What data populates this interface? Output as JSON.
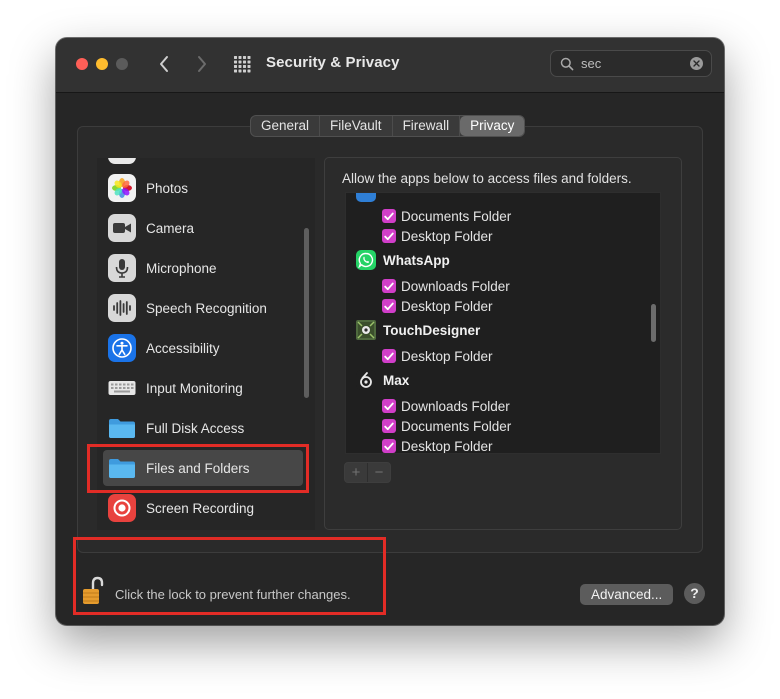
{
  "window": {
    "title": "Security & Privacy"
  },
  "search": {
    "value": "sec"
  },
  "tabs": [
    {
      "label": "General",
      "active": false
    },
    {
      "label": "FileVault",
      "active": false
    },
    {
      "label": "Firewall",
      "active": false
    },
    {
      "label": "Privacy",
      "active": true
    }
  ],
  "sidebar": {
    "items": [
      {
        "label": "Photos",
        "icon": "photos-icon"
      },
      {
        "label": "Camera",
        "icon": "camera-icon"
      },
      {
        "label": "Microphone",
        "icon": "microphone-icon"
      },
      {
        "label": "Speech Recognition",
        "icon": "speech-recognition-icon"
      },
      {
        "label": "Accessibility",
        "icon": "accessibility-icon"
      },
      {
        "label": "Input Monitoring",
        "icon": "keyboard-icon"
      },
      {
        "label": "Full Disk Access",
        "icon": "folder-icon"
      },
      {
        "label": "Files and Folders",
        "icon": "folder-icon",
        "selected": true
      },
      {
        "label": "Screen Recording",
        "icon": "screen-recording-icon"
      }
    ]
  },
  "panel": {
    "description": "Allow the apps below to access files and folders.",
    "apps": [
      {
        "name": "WhatsApp",
        "icon": "whatsapp-icon"
      },
      {
        "name": "TouchDesigner",
        "icon": "touchdesigner-icon"
      },
      {
        "name": "Max",
        "icon": "max-icon"
      }
    ],
    "permissions": {
      "first_documents": "Documents Folder",
      "first_desktop": "Desktop Folder",
      "whatsapp_downloads": "Downloads Folder",
      "whatsapp_desktop": "Desktop Folder",
      "touchdesigner_desktop": "Desktop Folder",
      "max_downloads": "Downloads Folder",
      "max_documents": "Documents Folder",
      "max_desktop": "Desktop Folder"
    },
    "add_label": "+",
    "remove_label": "−"
  },
  "footer": {
    "lock_text": "Click the lock to prevent further changes.",
    "advanced_label": "Advanced...",
    "help_label": "?"
  },
  "colors": {
    "checkbox": "#d13ec9",
    "highlight": "#e22c26"
  }
}
